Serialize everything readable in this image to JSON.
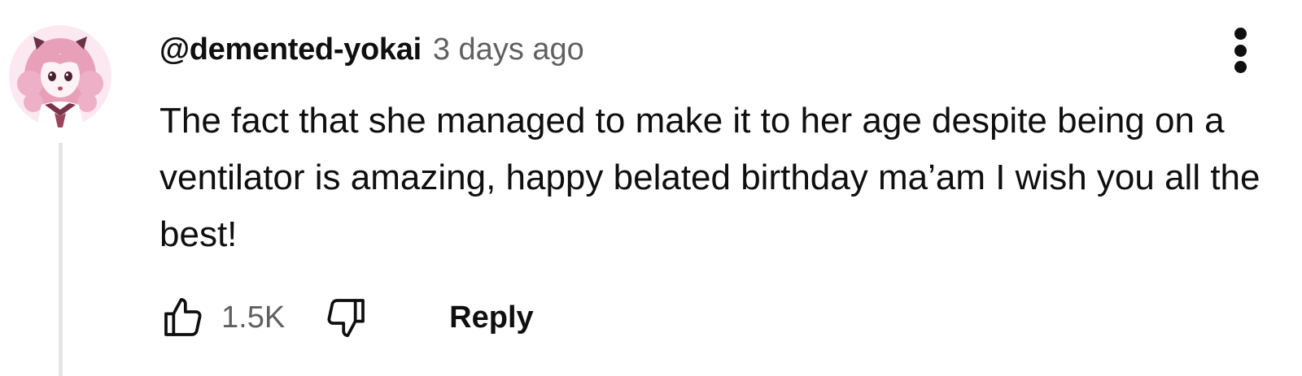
{
  "comment": {
    "author": "@demented-yokai",
    "timestamp": "3 days ago",
    "text": "The fact that she managed to make it to her age despite being on a ventilator is amazing, happy belated birthday ma’am I wish you all the best!",
    "like_count": "1.5K",
    "reply_label": "Reply"
  },
  "icons": {
    "avatar": "anime-avatar",
    "menu": "more-vertical-icon",
    "like": "thumbs-up-icon",
    "dislike": "thumbs-down-icon"
  },
  "colors": {
    "text_primary": "#0f0f0f",
    "text_secondary": "#606060",
    "thread_line": "#e5e5e5",
    "avatar_background": "#fbe8f0",
    "avatar_hair": "#e8a0b8"
  }
}
